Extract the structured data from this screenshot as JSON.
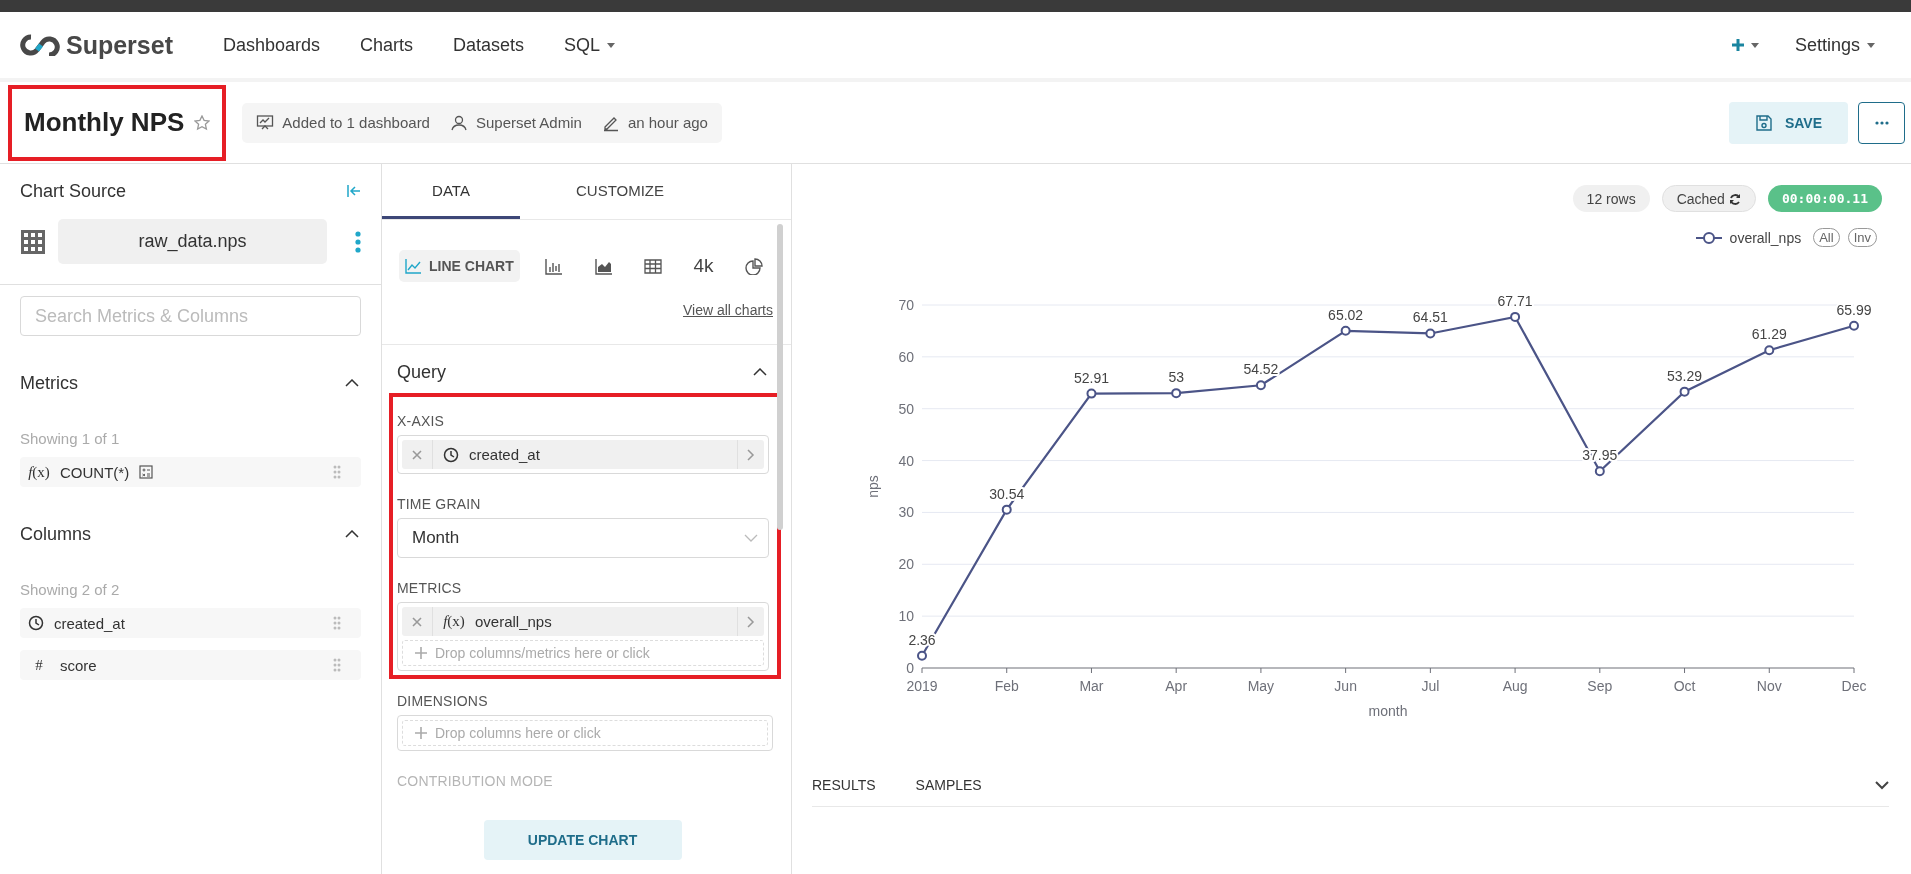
{
  "navbar": {
    "brand": "Superset",
    "items": [
      {
        "label": "Dashboards",
        "dropdown": false
      },
      {
        "label": "Charts",
        "dropdown": false
      },
      {
        "label": "Datasets",
        "dropdown": false
      },
      {
        "label": "SQL",
        "dropdown": true
      }
    ],
    "right": [
      {
        "kind": "add",
        "dropdown": true
      },
      {
        "kind": "text",
        "label": "Settings",
        "dropdown": true
      }
    ]
  },
  "header": {
    "title": "Monthly NPS",
    "starred": false,
    "highlighted": true,
    "meta": [
      {
        "kind": "dashboard",
        "text": "Added to 1 dashboard"
      },
      {
        "kind": "user",
        "text": "Superset Admin"
      },
      {
        "kind": "edit",
        "text": "an hour ago"
      }
    ],
    "save_label": "SAVE"
  },
  "datasource_panel": {
    "title": "Chart Source",
    "dataset": "raw_data.nps",
    "search": {
      "placeholder": "Search Metrics & Columns"
    },
    "sections": [
      {
        "title": "Metrics",
        "expanded": true,
        "count": "Showing 1 of 1",
        "items": [
          {
            "kind": "metric",
            "symbol": "*f*(x)",
            "label": "COUNT(*)",
            "calculated": true
          }
        ]
      },
      {
        "title": "Columns",
        "expanded": true,
        "count": "Showing 2 of 2",
        "items": [
          {
            "kind": "time",
            "label": "created_at",
            "calculated": false
          },
          {
            "kind": "number",
            "symbol": "#",
            "label": "score",
            "calculated": false
          }
        ]
      }
    ]
  },
  "controls_panel": {
    "tabs": [
      {
        "label": "DATA",
        "selected": true
      },
      {
        "label": "CUSTOMIZE",
        "selected": false
      }
    ],
    "viz_types": [
      {
        "kind": "line",
        "label": "LINE CHART",
        "selected": true
      },
      {
        "kind": "bar",
        "selected": false
      },
      {
        "kind": "area",
        "selected": false
      },
      {
        "kind": "table",
        "selected": false
      },
      {
        "kind": "big-number",
        "label": "4k",
        "selected": false
      },
      {
        "kind": "pie",
        "selected": false
      }
    ],
    "view_all": "View all charts",
    "section": {
      "title": "Query",
      "expanded": true,
      "controls": [
        {
          "kind": "dnd",
          "label": "X-AXIS",
          "highlighted": true,
          "values": [
            {
              "kind": "time",
              "label": "created_at"
            }
          ]
        },
        {
          "kind": "select",
          "label": "TIME GRAIN",
          "highlighted": true,
          "value": "Month"
        },
        {
          "kind": "dnd",
          "label": "METRICS",
          "highlighted": true,
          "values": [
            {
              "kind": "metric",
              "symbol": "*f*(x)",
              "label": "overall_nps"
            }
          ],
          "drop_placeholder": "Drop columns/metrics here or click"
        },
        {
          "kind": "dnd",
          "label": "DIMENSIONS",
          "highlighted": false,
          "drop_placeholder": "Drop columns here or click"
        },
        {
          "kind": "faded",
          "label": "CONTRIBUTION MODE",
          "highlighted": false
        }
      ]
    },
    "update_button": "UPDATE CHART"
  },
  "chart_panel": {
    "badges": [
      {
        "kind": "rows",
        "text": "12 rows"
      },
      {
        "kind": "cached",
        "text": "Cached"
      },
      {
        "kind": "timer",
        "text": "00:00:00.11"
      }
    ],
    "legend_buttons": [
      "All",
      "Inv"
    ],
    "chart_data": {
      "type": "line",
      "xlabel": "month",
      "ylabel": "nps",
      "categories": [
        "2019",
        "Feb",
        "Mar",
        "Apr",
        "May",
        "Jun",
        "Jul",
        "Aug",
        "Sep",
        "Oct",
        "Nov",
        "Dec"
      ],
      "ylim": [
        0,
        70
      ],
      "grid": true,
      "yticks": [
        0,
        10,
        20,
        30,
        40,
        50,
        60,
        70
      ],
      "data_labels": true,
      "series": [
        {
          "name": "overall_nps",
          "color": "#4b5487",
          "marker": "circle",
          "values": [
            2.36,
            30.54,
            52.91,
            53,
            54.52,
            65.02,
            64.51,
            67.71,
            37.95,
            53.29,
            61.29,
            65.99
          ]
        }
      ]
    },
    "bottom_tabs": [
      {
        "label": "RESULTS",
        "selected": false
      },
      {
        "label": "SAMPLES",
        "selected": false
      }
    ]
  }
}
